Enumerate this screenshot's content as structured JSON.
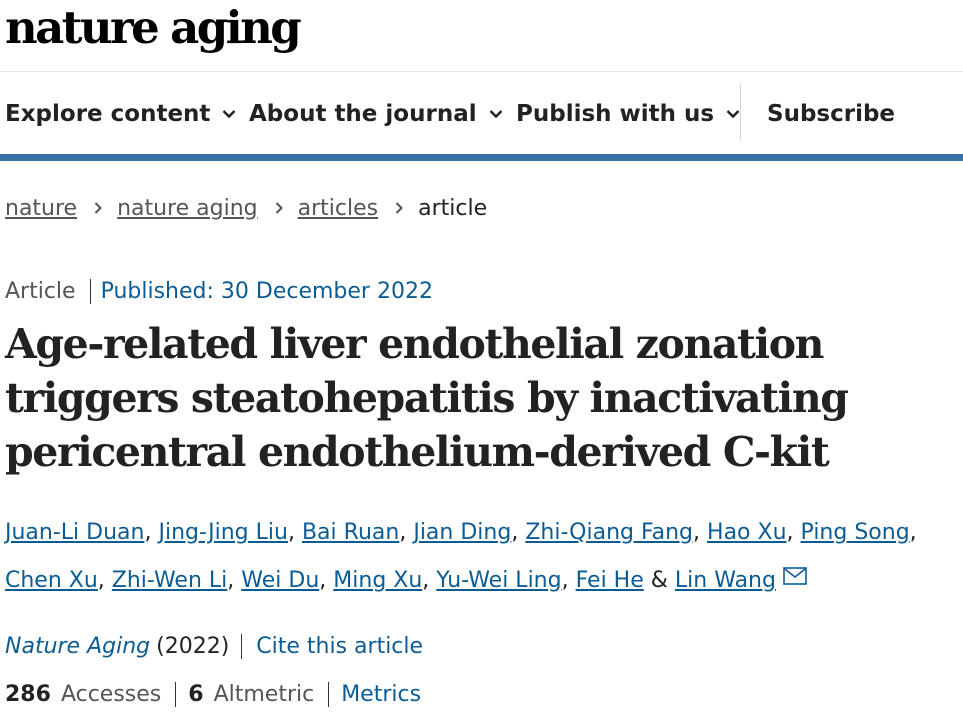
{
  "site": {
    "logo": "nature aging"
  },
  "nav": {
    "items": [
      {
        "label": "Explore content"
      },
      {
        "label": "About the journal"
      },
      {
        "label": "Publish with us"
      }
    ],
    "subscribe": "Subscribe"
  },
  "breadcrumb": {
    "items": [
      "nature",
      "nature aging",
      "articles"
    ],
    "current": "article"
  },
  "article": {
    "type": "Article",
    "published": "Published: 30 December 2022",
    "title": "Age-related liver endothelial zonation triggers steatohepatitis by inactivating pericentral endothelium-derived C-kit",
    "authors": [
      "Juan-Li Duan",
      "Jing-Jing Liu",
      "Bai Ruan",
      "Jian Ding",
      "Zhi-Qiang Fang",
      "Hao Xu",
      "Ping Song",
      "Chen Xu",
      "Zhi-Wen Li",
      "Wei Du",
      "Ming Xu",
      "Yu-Wei Ling",
      "Fei He",
      "Lin Wang"
    ],
    "separator": ",",
    "ampersand": "&",
    "citation": {
      "journal": "Nature Aging",
      "year": "(2022)",
      "cite_link": "Cite this article"
    },
    "metrics": {
      "accesses_value": "286",
      "accesses_label": "Accesses",
      "altmetric_value": "6",
      "altmetric_label": "Altmetric",
      "metrics_link": "Metrics"
    }
  },
  "colors": {
    "link": "#0c5c94",
    "nav_bar": "#3572a5"
  },
  "icons": {
    "nav_chevron": "chevron-down-icon",
    "crumb_chevron": "chevron-right-icon",
    "author_mail": "mail-icon"
  }
}
